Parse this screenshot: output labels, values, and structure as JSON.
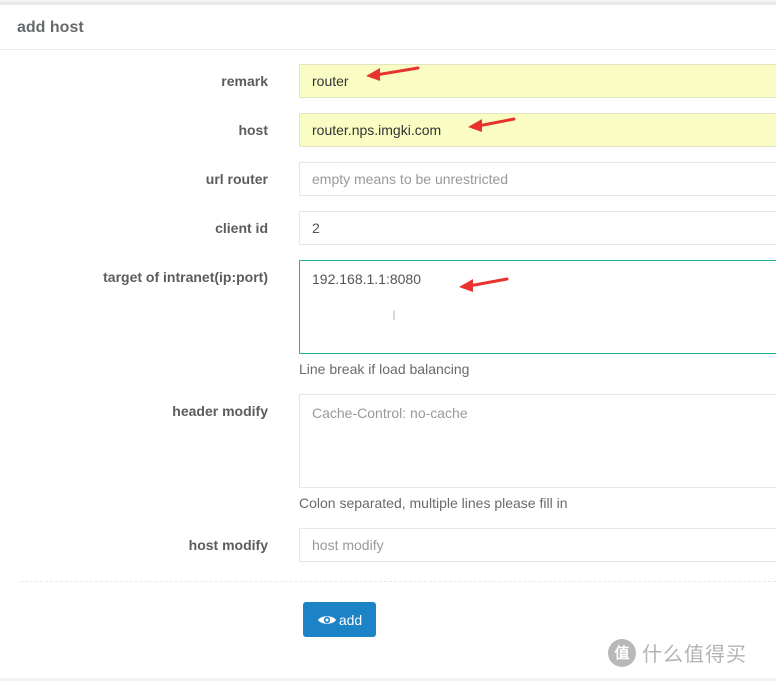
{
  "panel": {
    "title": "add host"
  },
  "form": {
    "remark": {
      "label": "remark",
      "value": "router"
    },
    "host": {
      "label": "host",
      "value": "router.nps.imgki.com"
    },
    "url_router": {
      "label": "url router",
      "placeholder": "empty means to be unrestricted"
    },
    "client_id": {
      "label": "client id",
      "value": "2"
    },
    "target": {
      "label": "target of intranet(ip:port)",
      "value": "192.168.1.1:8080",
      "help": "Line break if load balancing"
    },
    "header_modify": {
      "label": "header modify",
      "placeholder": "Cache-Control: no-cache",
      "help": "Colon separated, multiple lines please fill in"
    },
    "host_modify": {
      "label": "host modify",
      "placeholder": "host modify"
    }
  },
  "actions": {
    "add_label": "add",
    "add_icon": "eye-icon"
  },
  "watermark": {
    "badge": "值",
    "text": "什么值得买"
  },
  "colors": {
    "primary": "#1c84c6",
    "focus_border": "#1ab394",
    "highlight_bg": "#fafdc3",
    "annotation_arrow": "#e8322e"
  }
}
